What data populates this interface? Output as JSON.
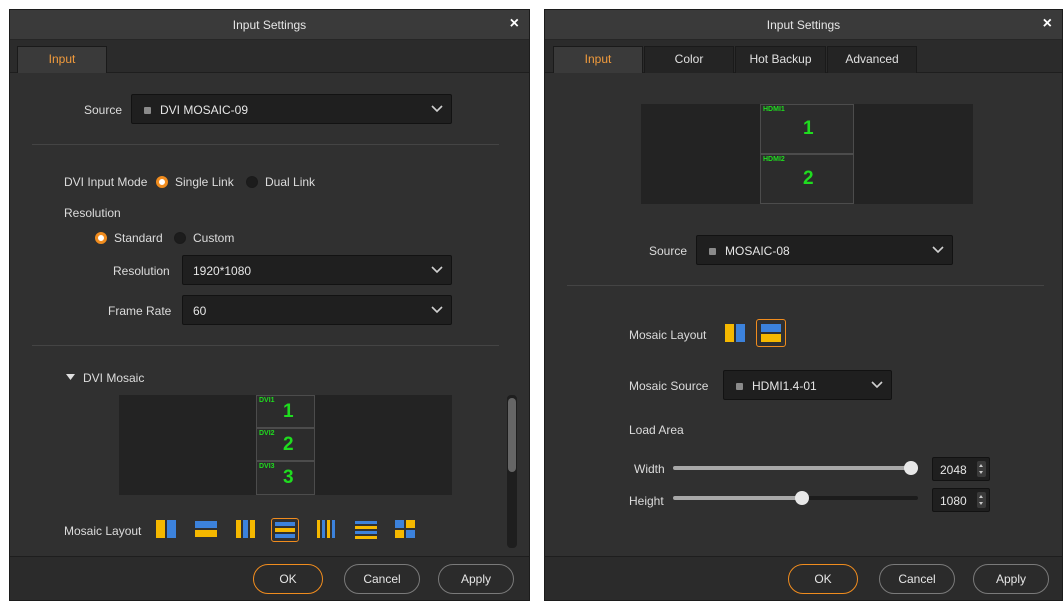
{
  "left_dialog": {
    "title": "Input Settings",
    "close_glyph": "×",
    "tabs": [
      {
        "label": "Input",
        "active": true
      }
    ],
    "source": {
      "label": "Source",
      "value": "DVI MOSAIC-09"
    },
    "dvi_input_mode": {
      "label": "DVI Input Mode",
      "options": [
        "Single Link",
        "Dual Link"
      ],
      "selected": "Single Link"
    },
    "resolution_section": {
      "title": "Resolution",
      "options": [
        "Standard",
        "Custom"
      ],
      "selected": "Standard",
      "resolution": {
        "label": "Resolution",
        "value": "1920*1080"
      },
      "frame_rate": {
        "label": "Frame Rate",
        "value": "60"
      }
    },
    "dvi_mosaic": {
      "title": "DVI Mosaic",
      "cells": [
        {
          "tag": "DVI1",
          "number": "1"
        },
        {
          "tag": "DVI2",
          "number": "2"
        },
        {
          "tag": "DVI3",
          "number": "3"
        }
      ],
      "mosaic_layout_label": "Mosaic Layout",
      "layout_icons": [
        "split-vertical-2",
        "split-horizontal-2",
        "split-vertical-3",
        "split-horizontal-3",
        "split-vertical-4",
        "split-horizontal-4",
        "grid-2x2"
      ],
      "selected_layout": "split-horizontal-3"
    },
    "buttons": {
      "ok": "OK",
      "cancel": "Cancel",
      "apply": "Apply"
    }
  },
  "right_dialog": {
    "title": "Input Settings",
    "close_glyph": "×",
    "tabs": [
      {
        "label": "Input",
        "active": true
      },
      {
        "label": "Color",
        "active": false
      },
      {
        "label": "Hot Backup",
        "active": false
      },
      {
        "label": "Advanced",
        "active": false
      }
    ],
    "preview_cells": [
      {
        "tag": "HDMI1",
        "number": "1"
      },
      {
        "tag": "HDMI2",
        "number": "2"
      }
    ],
    "source": {
      "label": "Source",
      "value": "MOSAIC-08"
    },
    "mosaic_layout": {
      "label": "Mosaic Layout",
      "icons": [
        "split-vertical-2",
        "split-horizontal-2"
      ],
      "selected": "split-horizontal-2"
    },
    "mosaic_source": {
      "label": "Mosaic Source",
      "value": "HDMI1.4-01"
    },
    "load_area": {
      "title": "Load Area",
      "width": {
        "label": "Width",
        "value": "2048",
        "slider_fraction": 1.0
      },
      "height": {
        "label": "Height",
        "value": "1080",
        "slider_fraction": 0.53
      }
    },
    "buttons": {
      "ok": "OK",
      "cancel": "Cancel",
      "apply": "Apply"
    }
  },
  "colors": {
    "accent": "#f08c1e",
    "active_tab_text": "#f29b3c",
    "mosaic_label": "#1fdc1f",
    "layout_icon_yellow": "#f5b800",
    "layout_icon_blue": "#3c82dc",
    "dialog_bg": "#303030"
  }
}
